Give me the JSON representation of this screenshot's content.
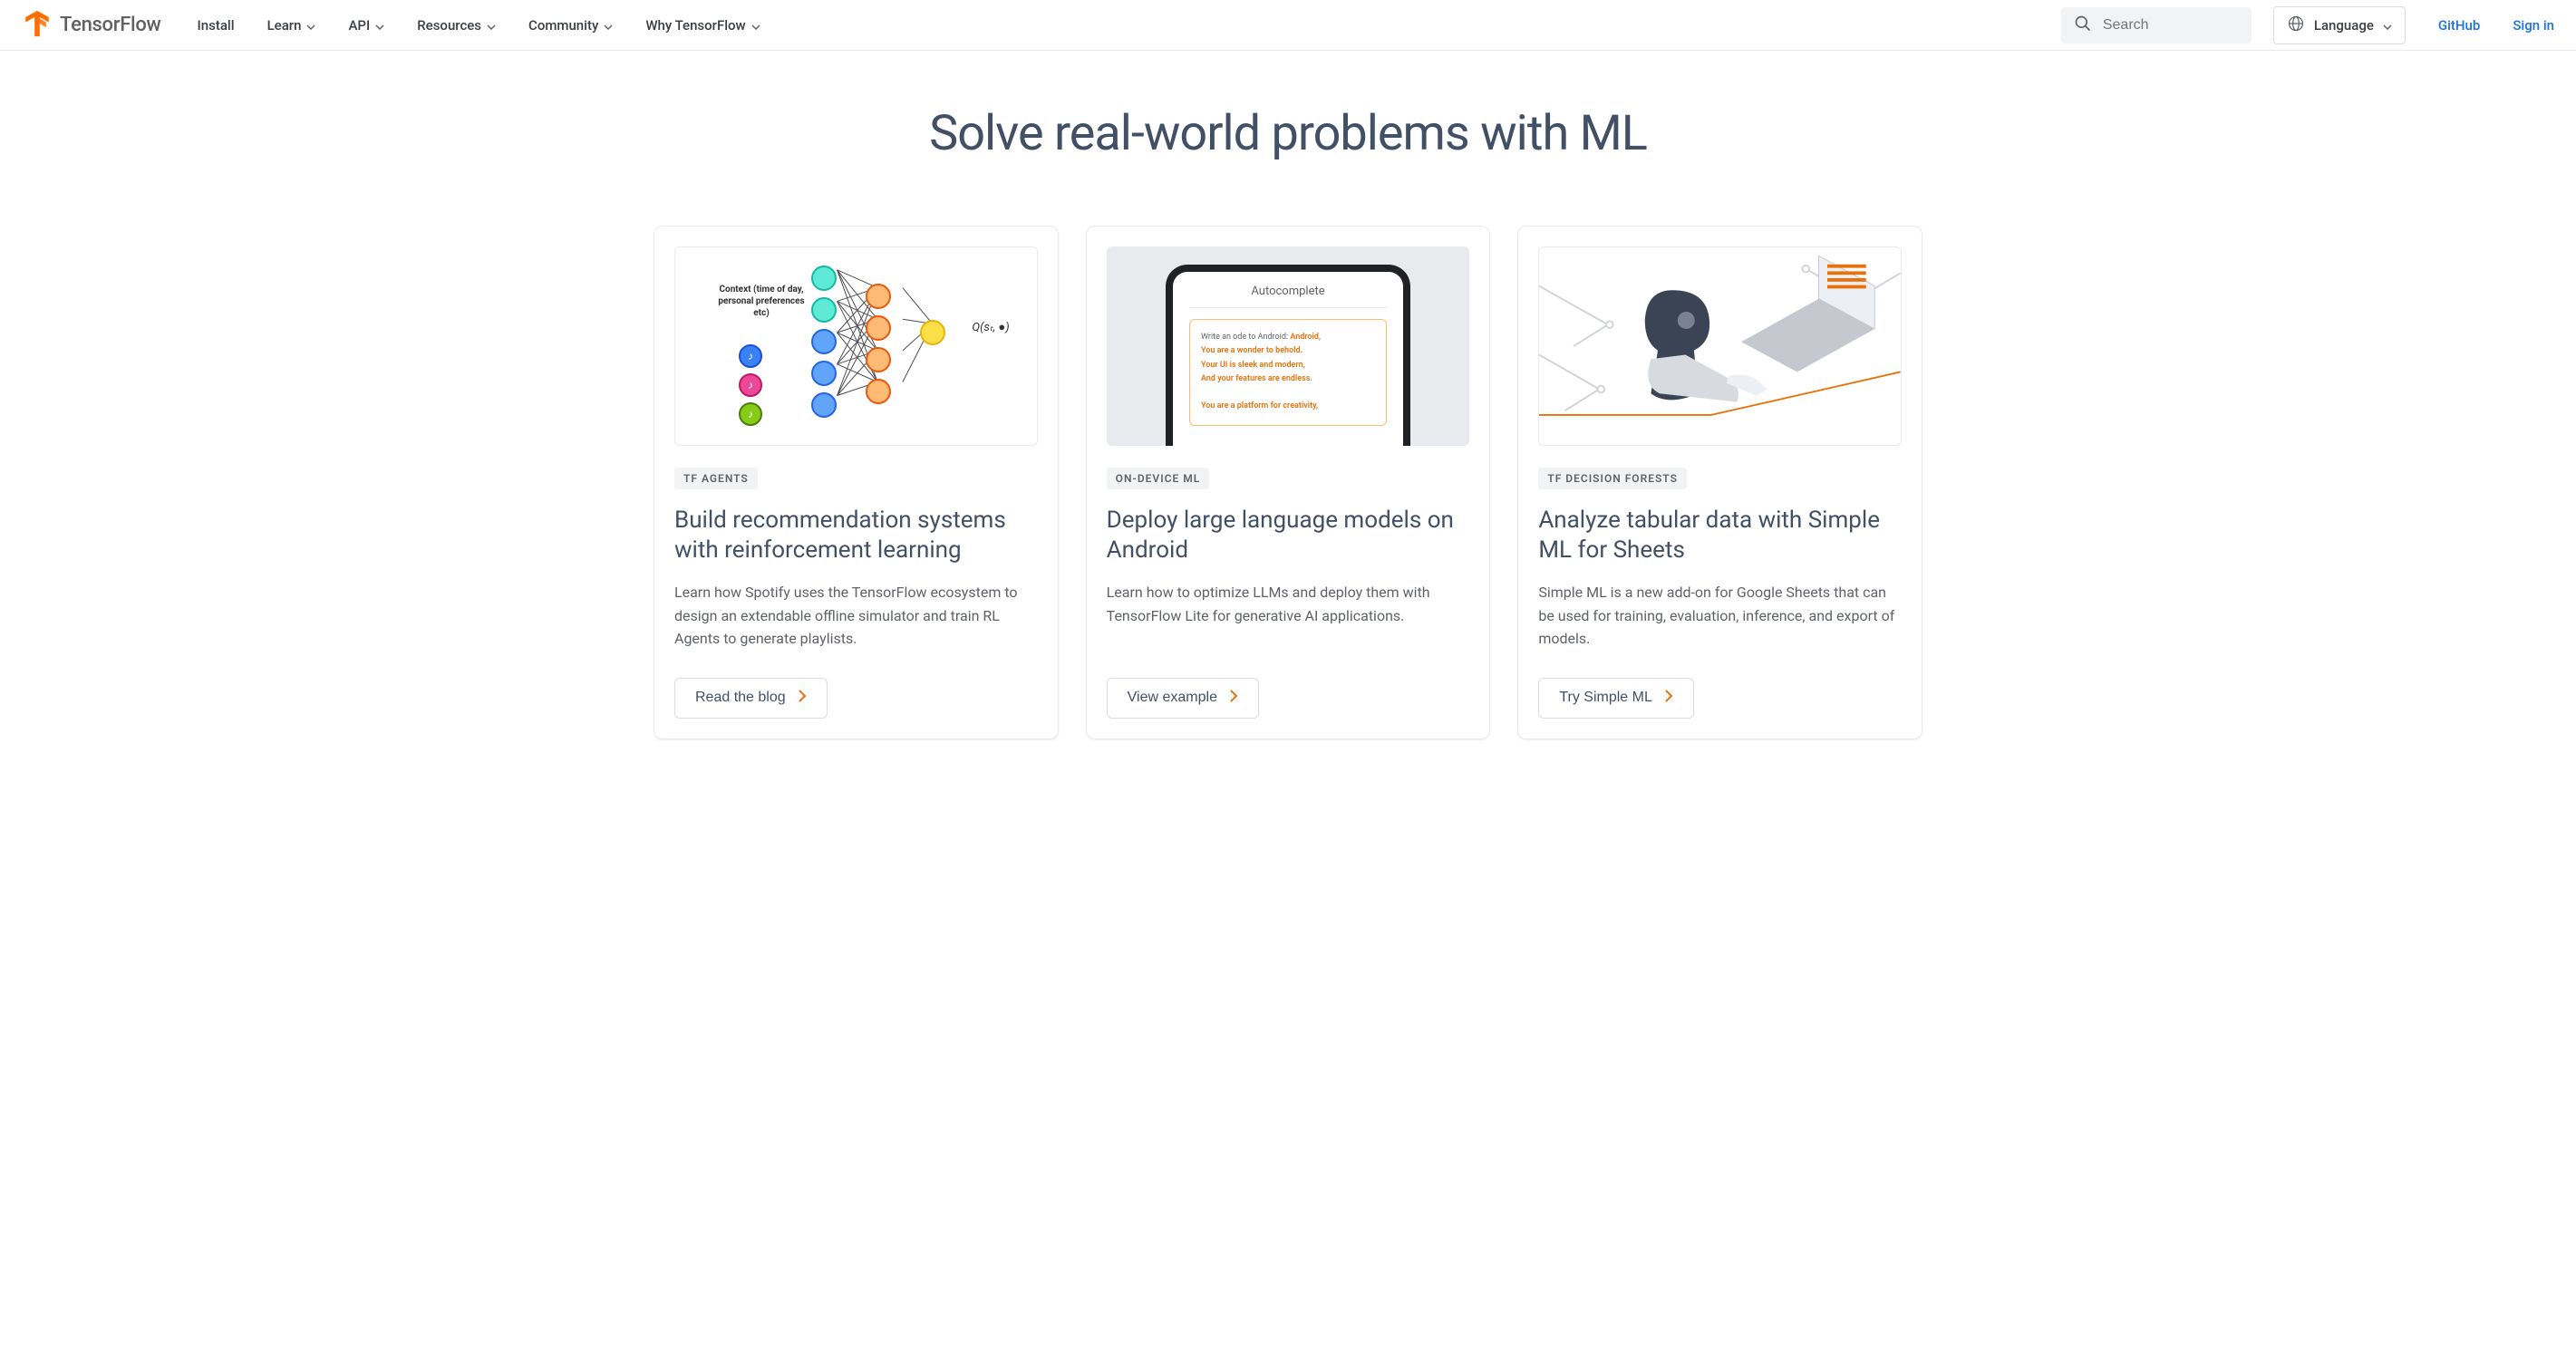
{
  "header": {
    "brand": "TensorFlow",
    "nav": [
      {
        "label": "Install",
        "dropdown": false
      },
      {
        "label": "Learn",
        "dropdown": true
      },
      {
        "label": "API",
        "dropdown": true
      },
      {
        "label": "Resources",
        "dropdown": true
      },
      {
        "label": "Community",
        "dropdown": true
      },
      {
        "label": "Why TensorFlow",
        "dropdown": true
      }
    ],
    "search_placeholder": "Search",
    "language_label": "Language",
    "github_label": "GitHub",
    "signin_label": "Sign in"
  },
  "main": {
    "title": "Solve real-world problems with ML"
  },
  "cards": [
    {
      "tag": "TF AGENTS",
      "title": "Build recommendation systems with reinforcement learning",
      "desc": "Learn how Spotify uses the TensorFlow ecosystem to design an extendable offline simulator and train RL Agents to generate playlists.",
      "cta": "Read the blog",
      "img_meta": {
        "context_label": "Context (time of day, personal preferences etc)",
        "q_label": "Q(sₜ, ●)"
      }
    },
    {
      "tag": "ON-DEVICE ML",
      "title": "Deploy large language models on Android",
      "desc": "Learn how to optimize LLMs and deploy them with TensorFlow Lite for generative AI applications.",
      "cta": "View example",
      "img_meta": {
        "phone_title": "Autocomplete",
        "prompt_prefix": "Write an ode to Android: ",
        "lines": [
          "Android,",
          "You are a wonder to behold.",
          "Your UI is sleek and modern,",
          "And your features are endless.",
          "",
          "You are a platform for creativity,"
        ]
      }
    },
    {
      "tag": "TF DECISION FORESTS",
      "title": "Analyze tabular data with Simple ML for Sheets",
      "desc": "Simple ML is a new add-on for Google Sheets that can be used for training, evaluation, inference, and export of models.",
      "cta": "Try Simple ML"
    }
  ]
}
